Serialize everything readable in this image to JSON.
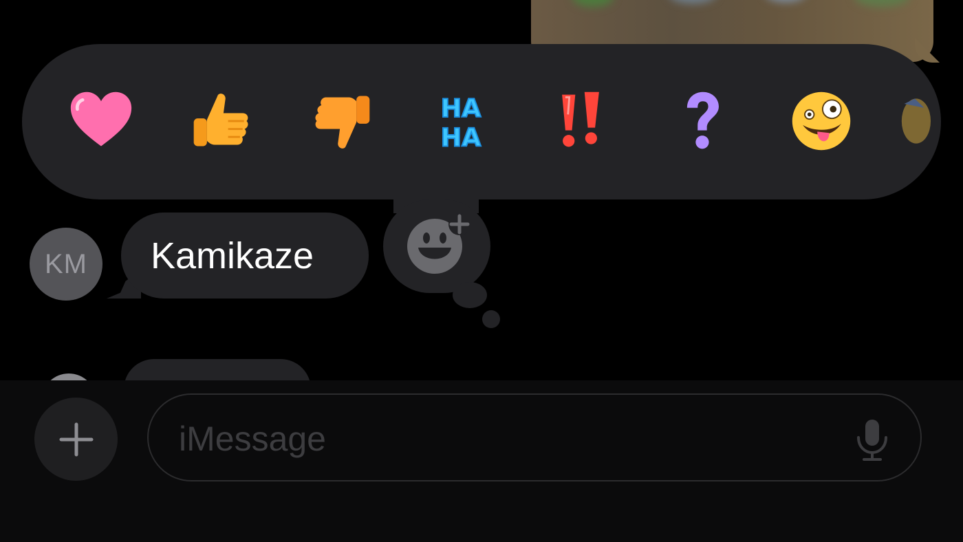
{
  "conversation": {
    "image_message": {
      "icon": "blurred-photo"
    },
    "tapback_bar": {
      "reactions": [
        {
          "name": "heart",
          "icon": "heart-icon"
        },
        {
          "name": "thumbs-up",
          "icon": "thumbs-up-icon"
        },
        {
          "name": "thumbs-down",
          "icon": "thumbs-down-icon"
        },
        {
          "name": "haha",
          "icon": "haha-icon",
          "text": [
            "HA",
            "HA"
          ]
        },
        {
          "name": "emphasize",
          "icon": "double-exclamation-icon"
        },
        {
          "name": "question",
          "icon": "question-icon"
        },
        {
          "name": "zany-face",
          "icon": "zany-face-icon"
        },
        {
          "name": "more",
          "icon": "partial-emoji-icon"
        }
      ],
      "add_emoji": {
        "icon": "emoji-add-icon"
      }
    },
    "received_message": {
      "avatar_initials": "KM",
      "text": "Kamikaze"
    }
  },
  "compose": {
    "plus_icon": "plus-icon",
    "placeholder": "iMessage",
    "value": "",
    "mic_icon": "microphone-icon"
  },
  "colors": {
    "background": "#000000",
    "bubble": "#232326",
    "avatar": "#545458",
    "placeholder": "#3d3d40",
    "heart": "#ff6fae",
    "thumbs": "#ffb02e",
    "haha": "#3ec6ff",
    "exclamation": "#ff453a",
    "question": "#b28cff"
  }
}
